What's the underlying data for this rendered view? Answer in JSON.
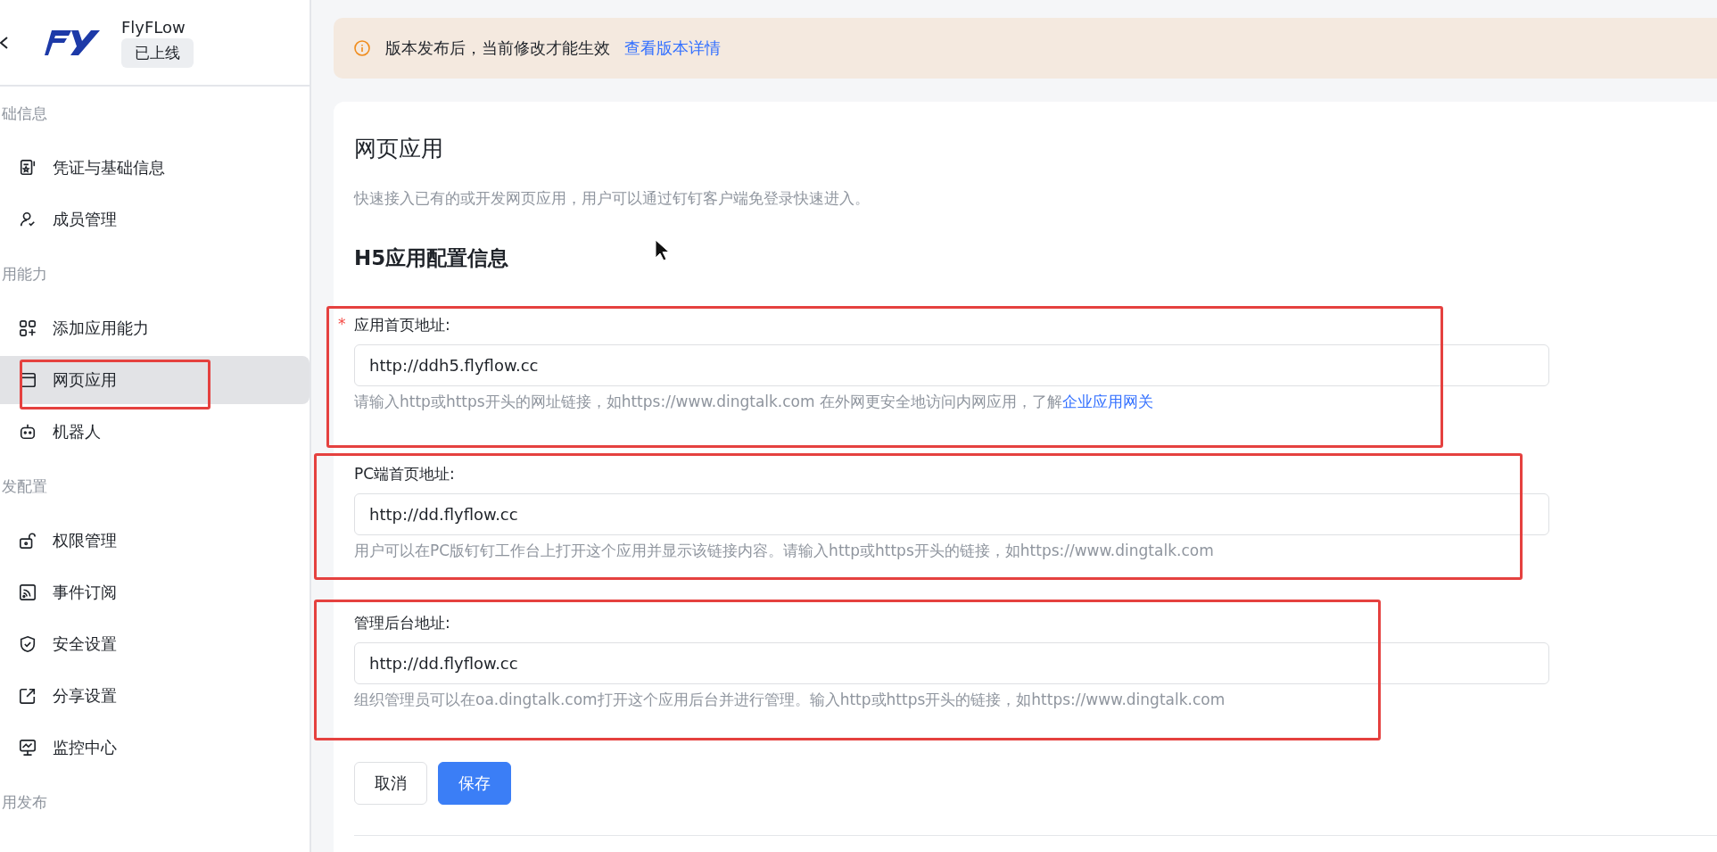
{
  "app": {
    "name": "FlyFLow",
    "status": "已上线"
  },
  "sidebar": {
    "groups": [
      {
        "label": "础信息",
        "items": [
          {
            "label": "凭证与基础信息",
            "selected": false
          },
          {
            "label": "成员管理",
            "selected": false
          }
        ]
      },
      {
        "label": "用能力",
        "items": [
          {
            "label": "添加应用能力",
            "selected": false
          },
          {
            "label": "网页应用",
            "selected": true
          },
          {
            "label": "机器人",
            "selected": false
          }
        ]
      },
      {
        "label": "发配置",
        "items": [
          {
            "label": "权限管理",
            "selected": false
          },
          {
            "label": "事件订阅",
            "selected": false
          },
          {
            "label": "安全设置",
            "selected": false
          },
          {
            "label": "分享设置",
            "selected": false
          },
          {
            "label": "监控中心",
            "selected": false
          }
        ]
      },
      {
        "label": "用发布"
      }
    ]
  },
  "notice": {
    "text": "版本发布后，当前修改才能生效",
    "link": "查看版本详情"
  },
  "page": {
    "title": "网页应用",
    "description": "快速接入已有的或开发网页应用，用户可以通过钉钉客户端免登录快速进入。",
    "section_title": "H5应用配置信息"
  },
  "fields": [
    {
      "label": "应用首页地址:",
      "required_mark": "*",
      "value": "http://ddh5.flyflow.cc",
      "hint": "请输入http或https开头的网址链接，如https://www.dingtalk.com 在外网更安全地访问内网应用，了解",
      "hint_link": "企业应用网关"
    },
    {
      "label": "PC端首页地址:",
      "value": "http://dd.flyflow.cc",
      "hint": "用户可以在PC版钉钉工作台上打开这个应用并显示该链接内容。请输入http或https开头的链接，如https://www.dingtalk.com"
    },
    {
      "label": "管理后台地址:",
      "value": "http://dd.flyflow.cc",
      "hint": "组织管理员可以在oa.dingtalk.com打开这个应用后台并进行管理。输入http或https开头的链接，如https://www.dingtalk.com"
    }
  ],
  "buttons": [
    {
      "label": "取消",
      "kind": "default"
    },
    {
      "label": "保存",
      "kind": "primary"
    }
  ]
}
